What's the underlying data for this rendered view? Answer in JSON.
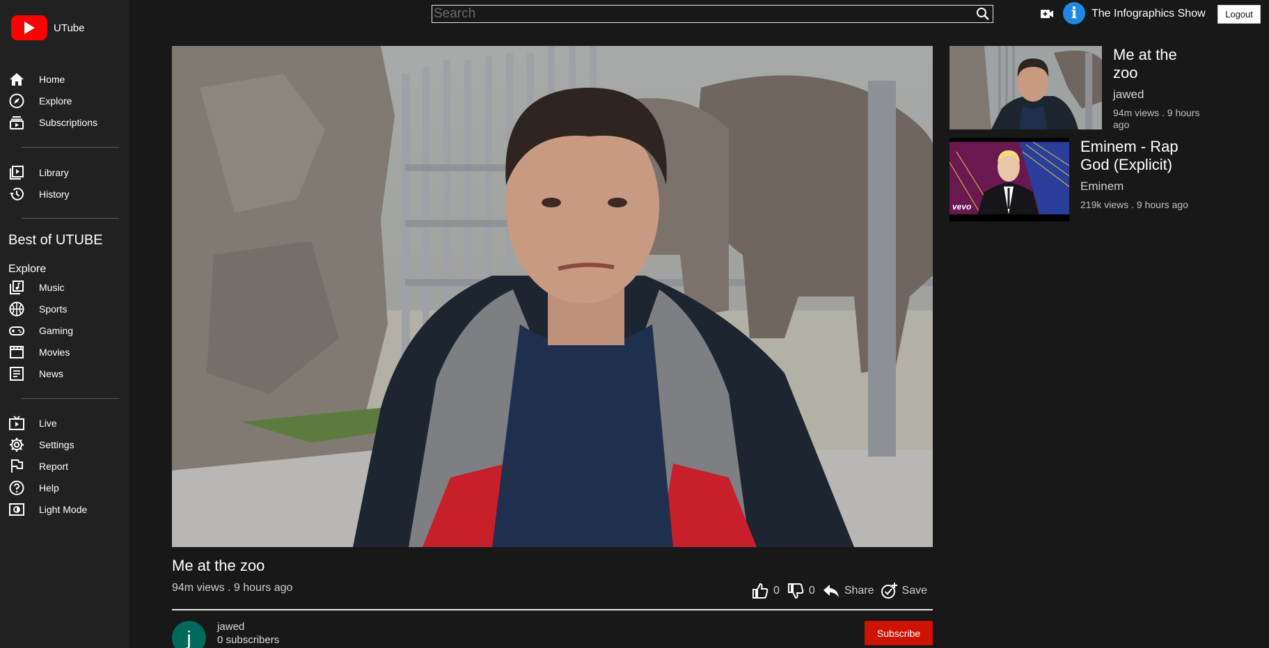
{
  "app": {
    "name": "UTube"
  },
  "search": {
    "placeholder": "Search",
    "value": ""
  },
  "header": {
    "channel_name": "The Infographics Show",
    "avatar_letter": "i",
    "logout_label": "Logout"
  },
  "sidebar": {
    "group1": [
      {
        "label": "Home",
        "icon": "home-icon"
      },
      {
        "label": "Explore",
        "icon": "compass-icon"
      },
      {
        "label": "Subscriptions",
        "icon": "subscriptions-icon"
      }
    ],
    "group2": [
      {
        "label": "Library",
        "icon": "library-icon"
      },
      {
        "label": "History",
        "icon": "history-icon"
      }
    ],
    "best_title": "Best of UTUBE",
    "explore_heading": "Explore",
    "group3": [
      {
        "label": "Music",
        "icon": "music-icon"
      },
      {
        "label": "Sports",
        "icon": "sports-icon"
      },
      {
        "label": "Gaming",
        "icon": "gaming-icon"
      },
      {
        "label": "Movies",
        "icon": "movies-icon"
      },
      {
        "label": "News",
        "icon": "news-icon"
      }
    ],
    "group4": [
      {
        "label": "Live",
        "icon": "live-icon"
      },
      {
        "label": "Settings",
        "icon": "gear-icon"
      },
      {
        "label": "Report",
        "icon": "flag-icon"
      },
      {
        "label": "Help",
        "icon": "help-icon"
      },
      {
        "label": "Light Mode",
        "icon": "light-mode-icon"
      }
    ]
  },
  "video": {
    "title": "Me at the zoo",
    "meta": "94m views . 9 hours ago",
    "likes": "0",
    "dislikes": "0",
    "share_label": "Share",
    "save_label": "Save",
    "uploader": {
      "name": "jawed",
      "subscribers": "0 subscribers",
      "avatar_letter": "j"
    },
    "subscribe_label": "Subscribe"
  },
  "recommendations": [
    {
      "title_line1": "Me at the",
      "title_line2": "zoo",
      "channel": "jawed",
      "meta_line1": "94m views . 9 hours",
      "meta_line2": "ago"
    },
    {
      "title_line1": "Eminem - Rap",
      "title_line2": "God (Explicit)",
      "channel": "Eminem",
      "meta_line1": "219k views . 9 hours ago",
      "thumb_badge": "vevo"
    }
  ],
  "colors": {
    "brand": "#ff0000",
    "subscribe": "#cc1400",
    "background": "#181818",
    "sidebar": "#212121"
  }
}
